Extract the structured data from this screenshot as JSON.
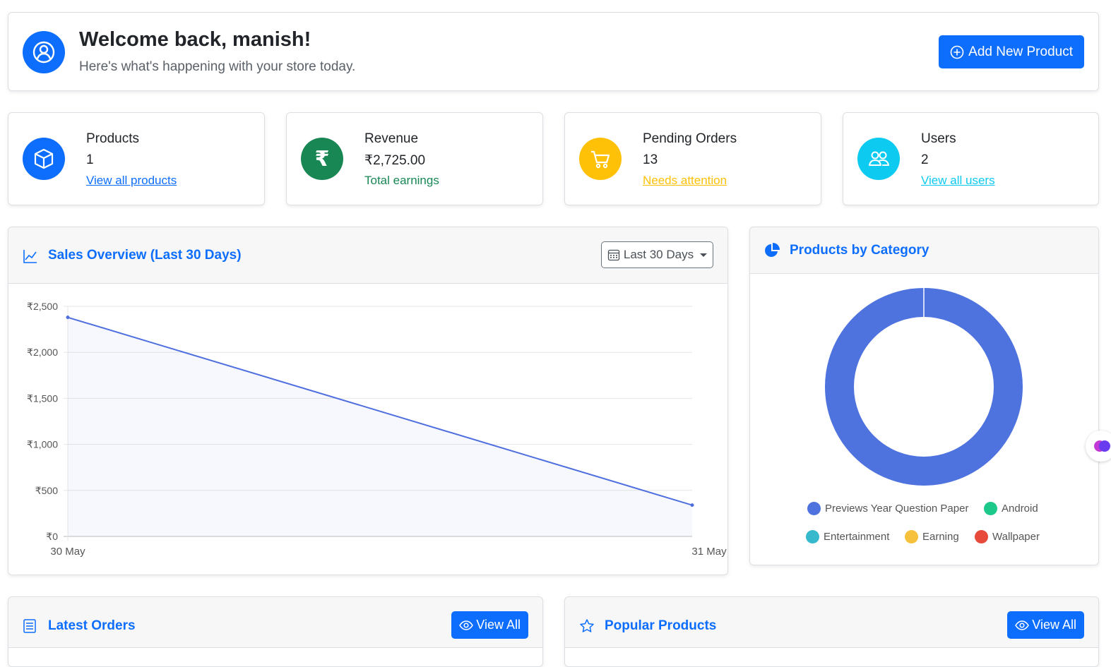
{
  "welcome": {
    "title": "Welcome back, manish!",
    "subtitle": "Here's what's happening with your store today.",
    "add_button": "Add New Product"
  },
  "stats": [
    {
      "label": "Products",
      "value": "1",
      "sub": "View all products",
      "color": "#0d6efd",
      "icon": "box-icon"
    },
    {
      "label": "Revenue",
      "value": "₹2,725.00",
      "sub": "Total earnings",
      "color": "#198754",
      "icon": "rupee-icon"
    },
    {
      "label": "Pending Orders",
      "value": "13",
      "sub": "Needs attention",
      "color": "#ffc107",
      "icon": "cart-icon"
    },
    {
      "label": "Users",
      "value": "2",
      "sub": "View all users",
      "color": "#0dcaf0",
      "icon": "people-icon"
    }
  ],
  "sales": {
    "title": "Sales Overview (Last 30 Days)",
    "range_label": "Last 30 Days"
  },
  "category": {
    "title": "Products by Category"
  },
  "bottom": {
    "orders_title": "Latest Orders",
    "popular_title": "Popular Products",
    "view_all": "View All"
  },
  "chart_data": [
    {
      "type": "line",
      "title": "",
      "x": [
        "30 May",
        "31 May"
      ],
      "series": [
        {
          "values": [
            2380,
            340
          ]
        }
      ],
      "ylim": [
        0,
        2500
      ],
      "yticks": [
        "₹0",
        "₹500",
        "₹1,000",
        "₹1,500",
        "₹2,000",
        "₹2,500"
      ],
      "ytick_values": [
        0,
        500,
        1000,
        1500,
        2000,
        2500
      ],
      "grid": true,
      "color": "#4f6fdf"
    },
    {
      "type": "pie",
      "title": "",
      "categories": [
        "Previews Year Question Paper",
        "Android",
        "Entertainment",
        "Earning",
        "Wallpaper"
      ],
      "values": [
        1,
        0,
        0,
        0,
        0
      ],
      "colors": [
        "#4e73df",
        "#1cc88a",
        "#36b9cc",
        "#f6c23e",
        "#e74a3b"
      ]
    }
  ]
}
